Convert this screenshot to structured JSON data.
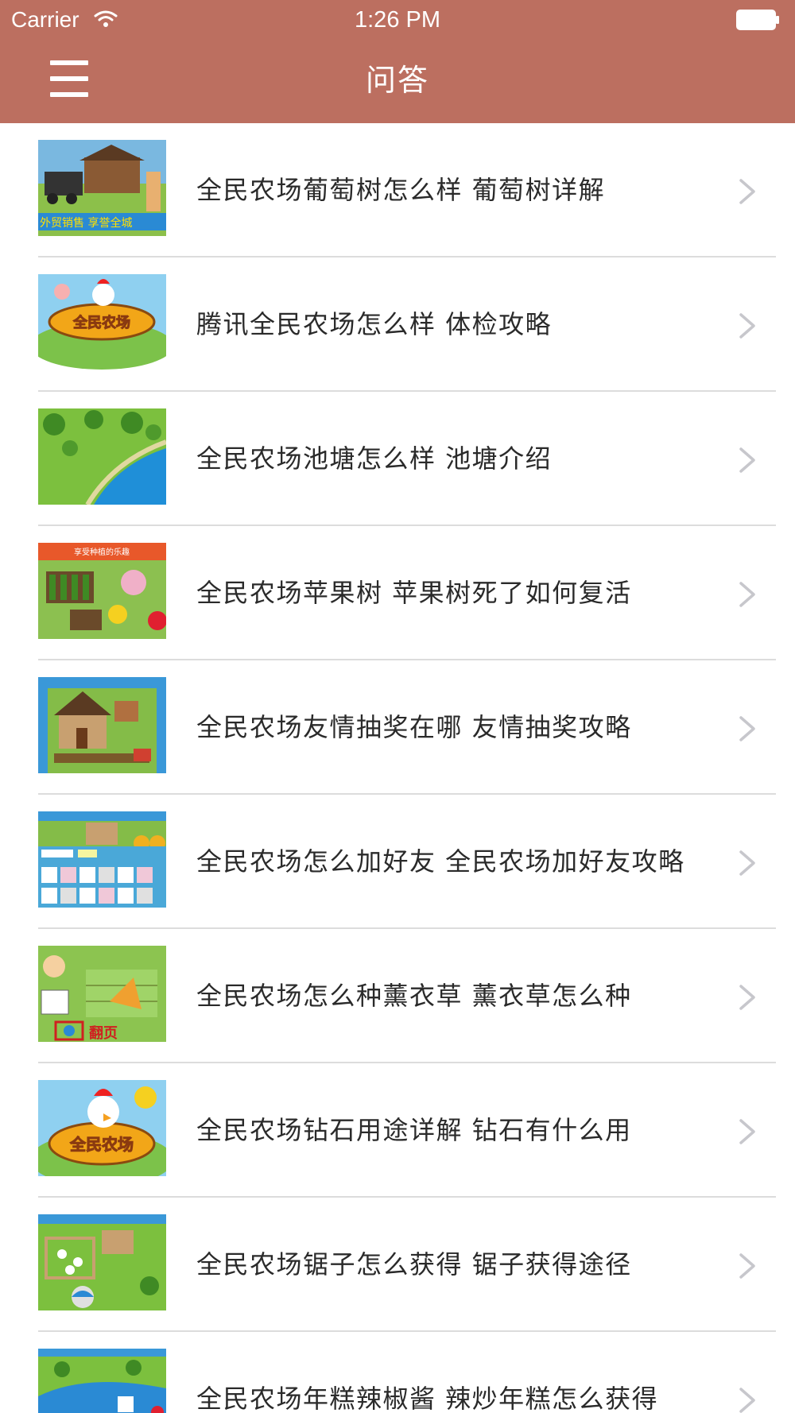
{
  "status_bar": {
    "carrier": "Carrier",
    "time": "1:26 PM"
  },
  "nav": {
    "title": "问答",
    "menu_icon": "hamburger-menu-icon"
  },
  "colors": {
    "nav_background": "#bc6f60",
    "nav_text": "#ffffff",
    "row_text": "#2a2a2a",
    "divider": "#dcdcdc",
    "chevron": "#c7c7cc"
  },
  "list": {
    "items": [
      {
        "title": "全民农场葡萄树怎么样 葡萄树详解",
        "thumb_text": "外贸销售 享誉全城"
      },
      {
        "title": "腾讯全民农场怎么样 体检攻略",
        "thumb_text": "全民农场"
      },
      {
        "title": "全民农场池塘怎么样 池塘介绍"
      },
      {
        "title": "全民农场苹果树 苹果树死了如何复活",
        "thumb_text": "享受种植的乐趣"
      },
      {
        "title": "全民农场友情抽奖在哪 友情抽奖攻略"
      },
      {
        "title": "全民农场怎么加好友 全民农场加好友攻略"
      },
      {
        "title": "全民农场怎么种薰衣草 薰衣草怎么种",
        "thumb_text": "翻页"
      },
      {
        "title": "全民农场钻石用途详解 钻石有什么用",
        "thumb_text": "全民农场"
      },
      {
        "title": "全民农场锯子怎么获得 锯子获得途径"
      },
      {
        "title": "全民农场年糕辣椒酱 辣炒年糕怎么获得"
      }
    ]
  }
}
